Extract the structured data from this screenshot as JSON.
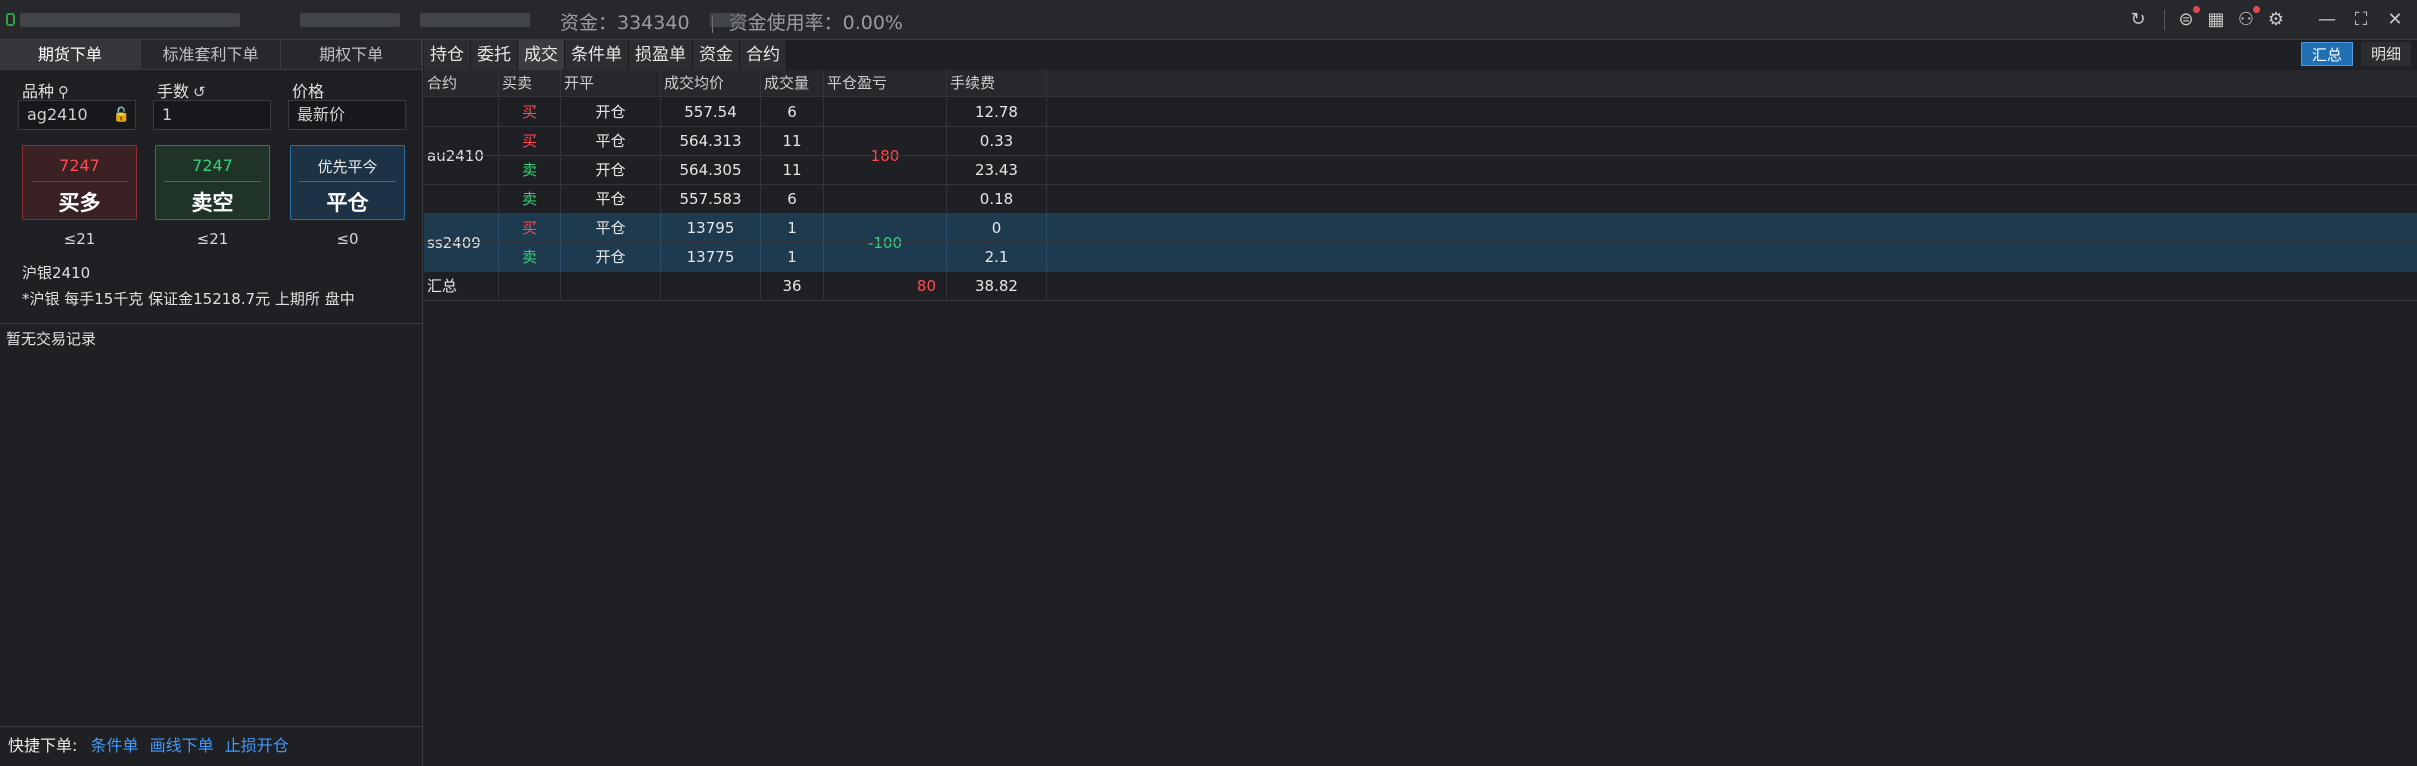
{
  "titlebar": {
    "equity_label": "资金：334340",
    "usage_label": "资金使用率：0.00%"
  },
  "left": {
    "tabs": [
      "期货下单",
      "标准套利下单",
      "期权下单"
    ],
    "labels": {
      "symbol": "品种",
      "qty": "手数",
      "price": "价格"
    },
    "inputs": {
      "symbol": "ag2410",
      "qty": "1",
      "price": "最新价"
    },
    "buttons": {
      "buy": {
        "price": "7247",
        "label": "买多"
      },
      "sell": {
        "price": "7247",
        "label": "卖空"
      },
      "close": {
        "price": "优先平今",
        "label": "平仓"
      }
    },
    "limits": {
      "buy": "≤21",
      "sell": "≤21",
      "close": "≤0"
    },
    "info_name": "沪银2410",
    "info_detail": "*沪银 每手15千克 保证金15218.7元 上期所 盘中",
    "no_record": "暂无交易记录",
    "quick": {
      "label": "快捷下单:",
      "links": [
        "条件单",
        "画线下单",
        "止损开仓"
      ]
    }
  },
  "right": {
    "tabs": [
      "持仓",
      "委托",
      "成交",
      "条件单",
      "损盈单",
      "资金",
      "合约"
    ],
    "active_tab": 2,
    "toggles": [
      "汇总",
      "明细"
    ],
    "columns": [
      "合约",
      "买卖",
      "开平",
      "成交均价",
      "成交量",
      "平仓盈亏",
      "手续费"
    ],
    "groups": [
      {
        "contract": "au2410",
        "pnl": "180",
        "pnl_color": "#ff4d4f",
        "rows": [
          {
            "side": "买",
            "side_color": "#ff4d4f",
            "open": "开仓",
            "avg": "557.54",
            "qty": "6",
            "fee": "12.78"
          },
          {
            "side": "买",
            "side_color": "#ff4d4f",
            "open": "平仓",
            "avg": "564.313",
            "qty": "11",
            "fee": "0.33"
          },
          {
            "side": "卖",
            "side_color": "#33d17a",
            "open": "开仓",
            "avg": "564.305",
            "qty": "11",
            "fee": "23.43"
          },
          {
            "side": "卖",
            "side_color": "#33d17a",
            "open": "平仓",
            "avg": "557.583",
            "qty": "6",
            "fee": "0.18"
          }
        ]
      },
      {
        "contract": "ss2409",
        "pnl": "-100",
        "pnl_color": "#33d17a",
        "rows": [
          {
            "side": "买",
            "side_color": "#ff4d4f",
            "open": "平仓",
            "avg": "13795",
            "qty": "1",
            "fee": "0"
          },
          {
            "side": "卖",
            "side_color": "#33d17a",
            "open": "开仓",
            "avg": "13775",
            "qty": "1",
            "fee": "2.1"
          }
        ]
      }
    ],
    "summary": {
      "label": "汇总",
      "qty": "36",
      "pnl": "80",
      "fee": "38.82"
    }
  }
}
